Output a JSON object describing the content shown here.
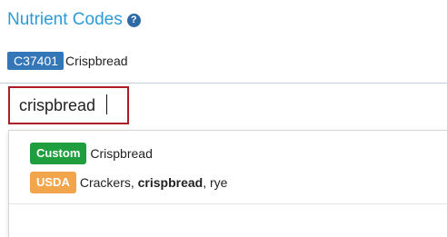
{
  "header": {
    "title": "Nutrient Codes",
    "help_symbol": "?"
  },
  "selected": {
    "code": "C37401",
    "name": "Crispbread"
  },
  "search": {
    "value": "crispbread"
  },
  "results": [
    {
      "source": "Custom",
      "text_before": "Crispbread",
      "match": "",
      "text_after": ""
    },
    {
      "source": "USDA",
      "text_before": "Crackers, ",
      "match": "crispbread",
      "text_after": ", rye"
    }
  ],
  "colors": {
    "title": "#2e9bd6",
    "code_badge": "#3477b8",
    "custom_badge": "#1e9e3e",
    "usda_badge": "#f2a54a",
    "highlight_border": "#b01c25"
  }
}
